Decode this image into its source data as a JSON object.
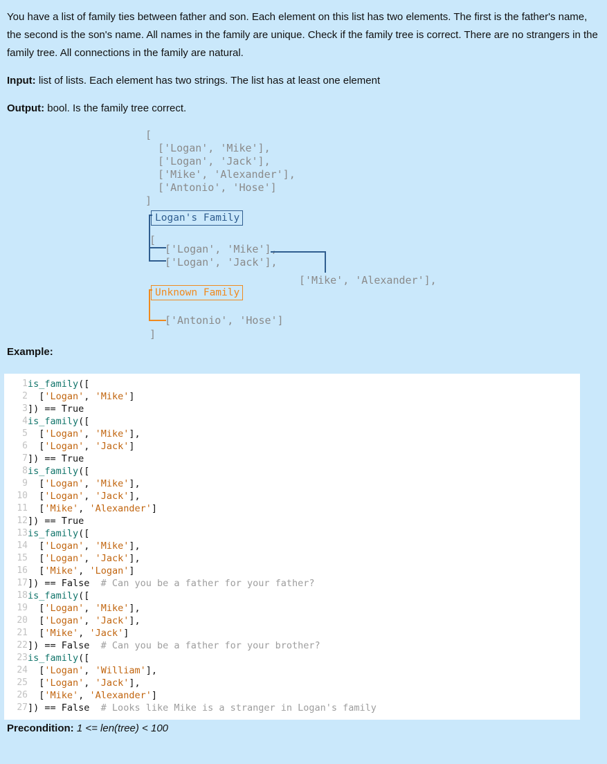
{
  "intro": {
    "paragraph": "You have a list of family ties between father and son. Each element on this list has two elements. The first is the father's name, the second is the son's name. All names in the family are unique. Check if the family tree is correct. There are no strangers in the family tree. All connections in the family are natural.",
    "input_label": "Input:",
    "input_text": " list of lists. Each element has two strings. The list has at least one element",
    "output_label": "Output:",
    "output_text": " bool. Is the family tree correct."
  },
  "diagram": {
    "top_list": [
      "[",
      "  ['Logan', 'Mike'],",
      "  ['Logan', 'Jack'],",
      "  ['Mike', 'Alexander'],",
      "  ['Antonio', 'Hose']",
      "]"
    ],
    "logans_family_label": "Logan's Family",
    "unknown_family_label": "Unknown Family",
    "open_bracket": "[",
    "logan_mike": "['Logan', 'Mike'],",
    "logan_jack": "['Logan', 'Jack'],",
    "mike_alexander": "['Mike', 'Alexander'],",
    "antonio_hose": "['Antonio', 'Hose']",
    "close_bracket": "]",
    "colors": {
      "known_family": "#2f5d8f",
      "unknown_family": "#f08a1e",
      "code_text": "#8a8a8a",
      "background": "#cae8fb"
    }
  },
  "example": {
    "heading": "Example:",
    "lines": [
      {
        "n": "1",
        "parts": [
          {
            "t": "fn",
            "v": "is_family"
          },
          {
            "t": "pl",
            "v": "(["
          }
        ]
      },
      {
        "n": "2",
        "parts": [
          {
            "t": "pl",
            "v": "  ["
          },
          {
            "t": "str",
            "v": "'Logan'"
          },
          {
            "t": "pl",
            "v": ", "
          },
          {
            "t": "str",
            "v": "'Mike'"
          },
          {
            "t": "pl",
            "v": "]"
          }
        ]
      },
      {
        "n": "3",
        "parts": [
          {
            "t": "pl",
            "v": "]) == "
          },
          {
            "t": "kw",
            "v": "True"
          }
        ]
      },
      {
        "n": "4",
        "parts": [
          {
            "t": "fn",
            "v": "is_family"
          },
          {
            "t": "pl",
            "v": "(["
          }
        ]
      },
      {
        "n": "5",
        "parts": [
          {
            "t": "pl",
            "v": "  ["
          },
          {
            "t": "str",
            "v": "'Logan'"
          },
          {
            "t": "pl",
            "v": ", "
          },
          {
            "t": "str",
            "v": "'Mike'"
          },
          {
            "t": "pl",
            "v": "],"
          }
        ]
      },
      {
        "n": "6",
        "parts": [
          {
            "t": "pl",
            "v": "  ["
          },
          {
            "t": "str",
            "v": "'Logan'"
          },
          {
            "t": "pl",
            "v": ", "
          },
          {
            "t": "str",
            "v": "'Jack'"
          },
          {
            "t": "pl",
            "v": "]"
          }
        ]
      },
      {
        "n": "7",
        "parts": [
          {
            "t": "pl",
            "v": "]) == "
          },
          {
            "t": "kw",
            "v": "True"
          }
        ]
      },
      {
        "n": "8",
        "parts": [
          {
            "t": "fn",
            "v": "is_family"
          },
          {
            "t": "pl",
            "v": "(["
          }
        ]
      },
      {
        "n": "9",
        "parts": [
          {
            "t": "pl",
            "v": "  ["
          },
          {
            "t": "str",
            "v": "'Logan'"
          },
          {
            "t": "pl",
            "v": ", "
          },
          {
            "t": "str",
            "v": "'Mike'"
          },
          {
            "t": "pl",
            "v": "],"
          }
        ]
      },
      {
        "n": "10",
        "parts": [
          {
            "t": "pl",
            "v": "  ["
          },
          {
            "t": "str",
            "v": "'Logan'"
          },
          {
            "t": "pl",
            "v": ", "
          },
          {
            "t": "str",
            "v": "'Jack'"
          },
          {
            "t": "pl",
            "v": "],"
          }
        ]
      },
      {
        "n": "11",
        "parts": [
          {
            "t": "pl",
            "v": "  ["
          },
          {
            "t": "str",
            "v": "'Mike'"
          },
          {
            "t": "pl",
            "v": ", "
          },
          {
            "t": "str",
            "v": "'Alexander'"
          },
          {
            "t": "pl",
            "v": "]"
          }
        ]
      },
      {
        "n": "12",
        "parts": [
          {
            "t": "pl",
            "v": "]) == "
          },
          {
            "t": "kw",
            "v": "True"
          }
        ]
      },
      {
        "n": "13",
        "parts": [
          {
            "t": "fn",
            "v": "is_family"
          },
          {
            "t": "pl",
            "v": "(["
          }
        ]
      },
      {
        "n": "14",
        "parts": [
          {
            "t": "pl",
            "v": "  ["
          },
          {
            "t": "str",
            "v": "'Logan'"
          },
          {
            "t": "pl",
            "v": ", "
          },
          {
            "t": "str",
            "v": "'Mike'"
          },
          {
            "t": "pl",
            "v": "],"
          }
        ]
      },
      {
        "n": "15",
        "parts": [
          {
            "t": "pl",
            "v": "  ["
          },
          {
            "t": "str",
            "v": "'Logan'"
          },
          {
            "t": "pl",
            "v": ", "
          },
          {
            "t": "str",
            "v": "'Jack'"
          },
          {
            "t": "pl",
            "v": "],"
          }
        ]
      },
      {
        "n": "16",
        "parts": [
          {
            "t": "pl",
            "v": "  ["
          },
          {
            "t": "str",
            "v": "'Mike'"
          },
          {
            "t": "pl",
            "v": ", "
          },
          {
            "t": "str",
            "v": "'Logan'"
          },
          {
            "t": "pl",
            "v": "]"
          }
        ]
      },
      {
        "n": "17",
        "parts": [
          {
            "t": "pl",
            "v": "]) == "
          },
          {
            "t": "kw",
            "v": "False"
          },
          {
            "t": "cmt",
            "v": "  # Can you be a father for your father?"
          }
        ]
      },
      {
        "n": "18",
        "parts": [
          {
            "t": "fn",
            "v": "is_family"
          },
          {
            "t": "pl",
            "v": "(["
          }
        ]
      },
      {
        "n": "19",
        "parts": [
          {
            "t": "pl",
            "v": "  ["
          },
          {
            "t": "str",
            "v": "'Logan'"
          },
          {
            "t": "pl",
            "v": ", "
          },
          {
            "t": "str",
            "v": "'Mike'"
          },
          {
            "t": "pl",
            "v": "],"
          }
        ]
      },
      {
        "n": "20",
        "parts": [
          {
            "t": "pl",
            "v": "  ["
          },
          {
            "t": "str",
            "v": "'Logan'"
          },
          {
            "t": "pl",
            "v": ", "
          },
          {
            "t": "str",
            "v": "'Jack'"
          },
          {
            "t": "pl",
            "v": "],"
          }
        ]
      },
      {
        "n": "21",
        "parts": [
          {
            "t": "pl",
            "v": "  ["
          },
          {
            "t": "str",
            "v": "'Mike'"
          },
          {
            "t": "pl",
            "v": ", "
          },
          {
            "t": "str",
            "v": "'Jack'"
          },
          {
            "t": "pl",
            "v": "]"
          }
        ]
      },
      {
        "n": "22",
        "parts": [
          {
            "t": "pl",
            "v": "]) == "
          },
          {
            "t": "kw",
            "v": "False"
          },
          {
            "t": "cmt",
            "v": "  # Can you be a father for your brother?"
          }
        ]
      },
      {
        "n": "23",
        "parts": [
          {
            "t": "fn",
            "v": "is_family"
          },
          {
            "t": "pl",
            "v": "(["
          }
        ]
      },
      {
        "n": "24",
        "parts": [
          {
            "t": "pl",
            "v": "  ["
          },
          {
            "t": "str",
            "v": "'Logan'"
          },
          {
            "t": "pl",
            "v": ", "
          },
          {
            "t": "str",
            "v": "'William'"
          },
          {
            "t": "pl",
            "v": "],"
          }
        ]
      },
      {
        "n": "25",
        "parts": [
          {
            "t": "pl",
            "v": "  ["
          },
          {
            "t": "str",
            "v": "'Logan'"
          },
          {
            "t": "pl",
            "v": ", "
          },
          {
            "t": "str",
            "v": "'Jack'"
          },
          {
            "t": "pl",
            "v": "],"
          }
        ]
      },
      {
        "n": "26",
        "parts": [
          {
            "t": "pl",
            "v": "  ["
          },
          {
            "t": "str",
            "v": "'Mike'"
          },
          {
            "t": "pl",
            "v": ", "
          },
          {
            "t": "str",
            "v": "'Alexander'"
          },
          {
            "t": "pl",
            "v": "]"
          }
        ]
      },
      {
        "n": "27",
        "parts": [
          {
            "t": "pl",
            "v": "]) == "
          },
          {
            "t": "kw",
            "v": "False"
          },
          {
            "t": "cmt",
            "v": "  # Looks like Mike is a stranger in Logan's family"
          }
        ]
      }
    ]
  },
  "precondition": {
    "label": "Precondition:",
    "value": " 1 <= len(tree) < 100"
  }
}
